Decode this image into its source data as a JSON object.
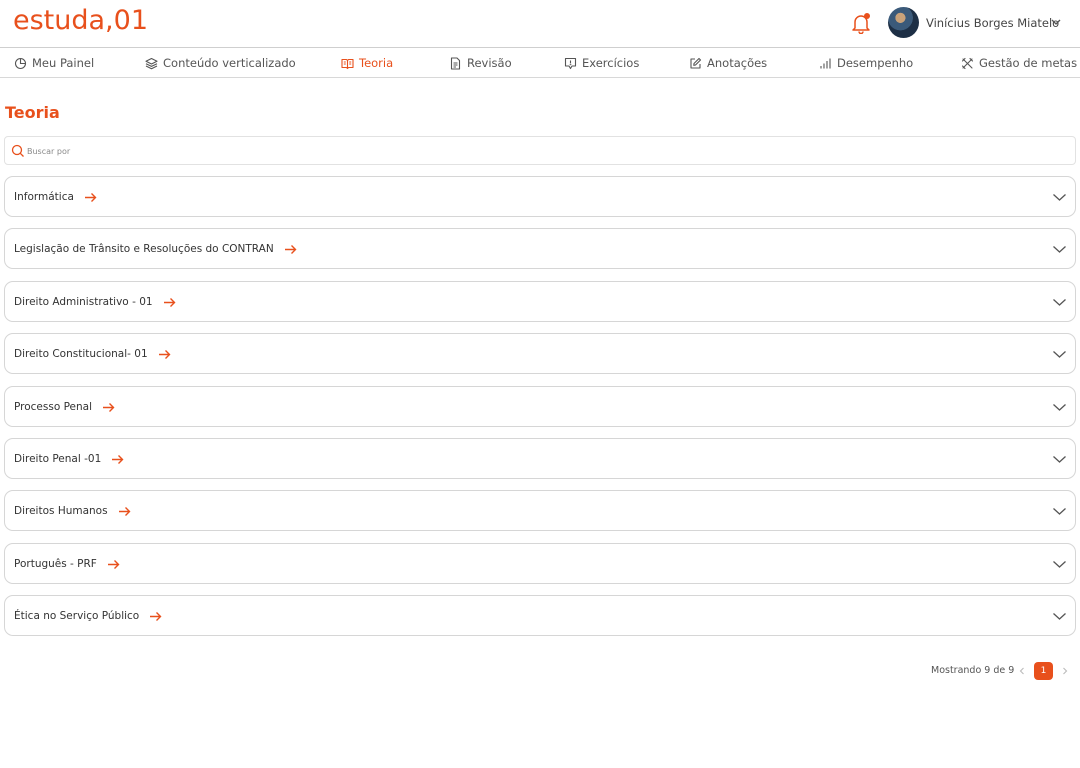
{
  "app": {
    "logo": "estuda,01"
  },
  "header": {
    "user_name": "Vinícius Borges Miatelo",
    "icons": {
      "notifications": "bell-icon",
      "user_menu": "chevron-down-icon"
    }
  },
  "colors": {
    "accent": "#e8501c",
    "text": "#333333",
    "border": "#d6d6d6"
  },
  "nav": {
    "items": [
      {
        "label": "Meu Painel",
        "icon": "dashboard-icon"
      },
      {
        "label": "Conteúdo verticalizado",
        "icon": "layers-icon"
      },
      {
        "label": "Teoria",
        "icon": "book-icon",
        "active": true
      },
      {
        "label": "Revisão",
        "icon": "document-icon"
      },
      {
        "label": "Exercícios",
        "icon": "exercise-icon"
      },
      {
        "label": "Anotações",
        "icon": "edit-icon"
      },
      {
        "label": "Desempenho",
        "icon": "bar-chart-icon"
      },
      {
        "label": "Gestão de metas",
        "icon": "tools-icon"
      }
    ]
  },
  "main": {
    "title": "Teoria",
    "search": {
      "placeholder": "Buscar por",
      "value": ""
    },
    "subjects": [
      {
        "label": "Informática"
      },
      {
        "label": "Legislação de Trânsito e Resoluções do CONTRAN"
      },
      {
        "label": "Direito Administrativo - 01"
      },
      {
        "label": "Direito Constitucional- 01"
      },
      {
        "label": "Processo Penal"
      },
      {
        "label": "Direito Penal -01"
      },
      {
        "label": "Direitos Humanos"
      },
      {
        "label": "Português - PRF"
      },
      {
        "label": "Ética no Serviço Público"
      }
    ]
  },
  "pagination": {
    "showing": "Mostrando 9 de 9",
    "current_page": "1"
  }
}
